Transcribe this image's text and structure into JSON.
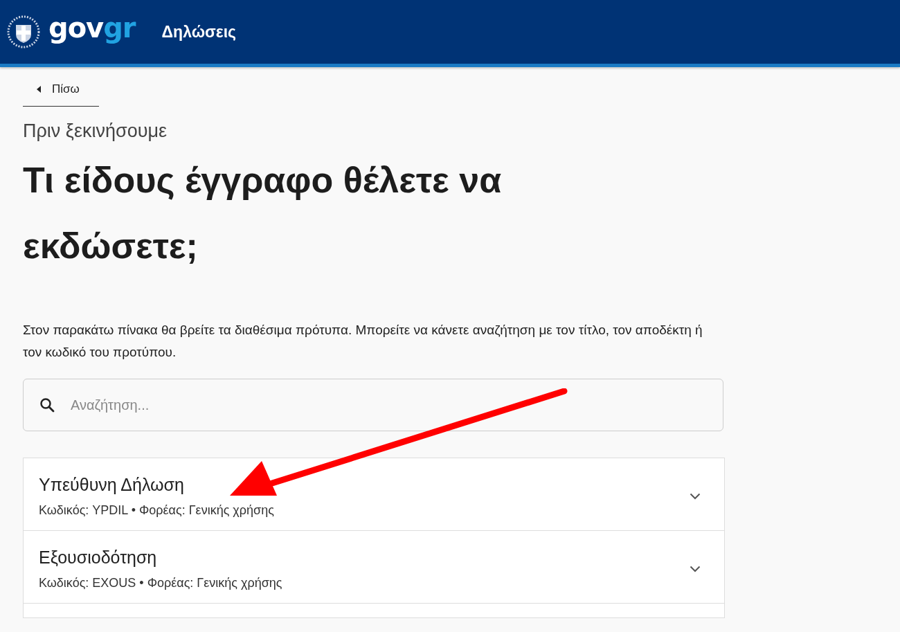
{
  "header": {
    "logo": {
      "part_1": "gov",
      "part_2": "gr"
    },
    "title": "Δηλώσεις"
  },
  "back_link": "Πίσω",
  "caption": "Πριν ξεκινήσουμε",
  "heading": "Τι είδους έγγραφο θέλετε να εκδώσετε;",
  "intro": "Στον παρακάτω πίνακα θα βρείτε τα διαθέσιμα πρότυπα. Μπορείτε να κάνετε αναζήτηση με τον τίτλο, τον αποδέκτη ή τον κωδικό του προτύπου.",
  "search": {
    "placeholder": "Αναζήτηση..."
  },
  "templates": [
    {
      "title": "Υπεύθυνη Δήλωση",
      "details": "Κωδικός: YPDIL • Φορέας: Γενικής χρήσης"
    },
    {
      "title": "Εξουσιοδότηση",
      "details": "Κωδικός: EXOUS • Φορέας: Γενικής χρήσης"
    }
  ]
}
